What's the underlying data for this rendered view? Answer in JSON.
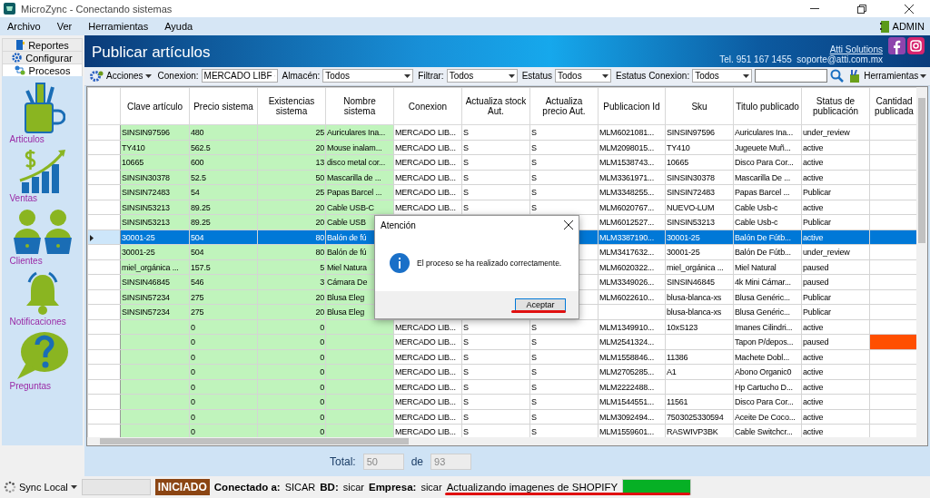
{
  "window": {
    "title": "MicroZync - Conectando sistemas"
  },
  "menu": [
    "Archivo",
    "Ver",
    "Herramientas",
    "Ayuda"
  ],
  "user": "ADMIN",
  "sidebar": {
    "tabs": [
      {
        "label": "Reportes",
        "kind": "book",
        "selected": false
      },
      {
        "label": "Configurar",
        "kind": "gear",
        "selected": false
      },
      {
        "label": "Procesos",
        "kind": "flow",
        "selected": true
      }
    ],
    "items": [
      {
        "label": "Articulos",
        "kind": "articles"
      },
      {
        "label": "Ventas",
        "kind": "sales"
      },
      {
        "label": "Clientes",
        "kind": "clients"
      },
      {
        "label": "Notificaciones",
        "kind": "bell"
      },
      {
        "label": "Preguntas",
        "kind": "question"
      }
    ]
  },
  "header": {
    "title": "Publicar artículos",
    "company": "Atti Solutions",
    "contact": "Tel. 951 167 1455  soporte@atti.com.mx"
  },
  "toolbar": {
    "actions": "Acciones",
    "filters": [
      {
        "label": "Conexion:",
        "value": "MERCADO LIBF"
      },
      {
        "label": "Almacén:",
        "value": "Todos"
      },
      {
        "label": "Filtrar:",
        "value": "Todos"
      },
      {
        "label": "Estatus",
        "value": "Todos"
      },
      {
        "label": "Estatus Conexion:",
        "value": "Todos"
      }
    ],
    "tools": "Herramientas"
  },
  "table": {
    "columns": [
      "Clave artículo",
      "Precio sistema",
      "Existencias sistema",
      "Nombre sistema",
      "Conexion",
      "Actualiza stock Aut.",
      "Actualiza precio Aut.",
      "Publicacion Id",
      "Sku",
      "Titulo publicado",
      "Status de publicación",
      "Cantidad publicada"
    ],
    "rows": [
      {
        "selected": false,
        "alert": false,
        "cells": [
          "SINSIN97596",
          "480",
          "25",
          "Auriculares Ina...",
          "MERCADO LIB...",
          "S",
          "S",
          "MLM6021081...",
          "SINSIN97596",
          "Auriculares Ina...",
          "under_review",
          null
        ]
      },
      {
        "selected": false,
        "alert": false,
        "cells": [
          "TY410",
          "562.5",
          "20",
          "Mouse inalam...",
          "MERCADO LIB...",
          "S",
          "S",
          "MLM2098015...",
          "TY410",
          "Jugeuete Muñ...",
          "active",
          null
        ]
      },
      {
        "selected": false,
        "alert": false,
        "cells": [
          "10665",
          "600",
          "13",
          "disco metal cor...",
          "MERCADO LIB...",
          "S",
          "S",
          "MLM1538743...",
          "10665",
          "Disco Para Cor...",
          "active",
          null
        ]
      },
      {
        "selected": false,
        "alert": false,
        "cells": [
          "SINSIN30378",
          "52.5",
          "50",
          "Mascarilla de ...",
          "MERCADO LIB...",
          "S",
          "S",
          "MLM3361971...",
          "SINSIN30378",
          "Mascarilla De ...",
          "active",
          null
        ]
      },
      {
        "selected": false,
        "alert": false,
        "cells": [
          "SINSIN72483",
          "54",
          "25",
          "Papas Barcel ...",
          "MERCADO LIB...",
          "S",
          "S",
          "MLM3348255...",
          "SINSIN72483",
          "Papas Barcel ...",
          "Publicar",
          null
        ]
      },
      {
        "selected": false,
        "alert": false,
        "cells": [
          "SINSIN53213",
          "89.25",
          "20",
          "Cable USB-C",
          "MERCADO LIB...",
          "S",
          "S",
          "MLM6020767...",
          "NUEVO-LUM",
          "Cable Usb-c",
          "active",
          null
        ]
      },
      {
        "selected": false,
        "alert": false,
        "cells": [
          "SINSIN53213",
          "89.25",
          "20",
          "Cable USB",
          null,
          null,
          null,
          "MLM6012527...",
          "SINSIN53213",
          "Cable Usb-c",
          "Publicar",
          null
        ]
      },
      {
        "selected": true,
        "alert": false,
        "cells": [
          "30001-25",
          "504",
          "80",
          "Balón de fú",
          null,
          null,
          null,
          "MLM3387190...",
          "30001-25",
          "Balón De Fútb...",
          "active",
          null
        ]
      },
      {
        "selected": false,
        "alert": false,
        "cells": [
          "30001-25",
          "504",
          "80",
          "Balón de fú",
          null,
          null,
          null,
          "MLM3417632...",
          "30001-25",
          "Balón De Fútb...",
          "under_review",
          null
        ]
      },
      {
        "selected": false,
        "alert": false,
        "cells": [
          "miel_orgánica ...",
          "157.5",
          "5",
          "Miel Natura",
          null,
          null,
          null,
          "MLM6020322...",
          "miel_orgánica ...",
          "Miel Natural",
          "paused",
          null
        ]
      },
      {
        "selected": false,
        "alert": false,
        "cells": [
          "SINSIN46845",
          "546",
          "3",
          "Cámara De",
          null,
          null,
          null,
          "MLM3349026...",
          "SINSIN46845",
          "4k Mini Cámar...",
          "paused",
          null
        ]
      },
      {
        "selected": false,
        "alert": false,
        "cells": [
          "SINSIN57234",
          "275",
          "20",
          "Blusa Eleg",
          null,
          null,
          null,
          "MLM6022610...",
          "blusa-blanca-xs",
          "Blusa Genéric...",
          "Publicar",
          null
        ]
      },
      {
        "selected": false,
        "alert": false,
        "cells": [
          "SINSIN57234",
          "275",
          "20",
          "Blusa Eleg",
          null,
          null,
          null,
          null,
          "blusa-blanca-xs",
          "Blusa Genéric...",
          "Publicar",
          null
        ]
      },
      {
        "selected": false,
        "alert": false,
        "cells": [
          null,
          "0",
          "0",
          null,
          "MERCADO LIB...",
          "S",
          "S",
          "MLM1349910...",
          "10xS123",
          "Imanes Cilindri...",
          "active",
          null
        ]
      },
      {
        "selected": false,
        "alert": true,
        "cells": [
          null,
          "0",
          "0",
          null,
          "MERCADO LIB...",
          "S",
          "S",
          "MLM2541324...",
          null,
          "Tapon P/depos...",
          "paused",
          null
        ]
      },
      {
        "selected": false,
        "alert": false,
        "cells": [
          null,
          "0",
          "0",
          null,
          "MERCADO LIB...",
          "S",
          "S",
          "MLM1558846...",
          "11386",
          "Machete Dobl...",
          "active",
          null
        ]
      },
      {
        "selected": false,
        "alert": false,
        "cells": [
          null,
          "0",
          "0",
          null,
          "MERCADO LIB...",
          "S",
          "S",
          "MLM2705285...",
          "A1",
          "Abono Organic0",
          "active",
          null
        ]
      },
      {
        "selected": false,
        "alert": false,
        "cells": [
          null,
          "0",
          "0",
          null,
          "MERCADO LIB...",
          "S",
          "S",
          "MLM2222488...",
          null,
          "Hp Cartucho D...",
          "active",
          null
        ]
      },
      {
        "selected": false,
        "alert": false,
        "cells": [
          null,
          "0",
          "0",
          null,
          "MERCADO LIB...",
          "S",
          "S",
          "MLM1544551...",
          "11561",
          "Disco Para Cor...",
          "active",
          null
        ]
      },
      {
        "selected": false,
        "alert": false,
        "cells": [
          null,
          "0",
          "0",
          null,
          "MERCADO LIB...",
          "S",
          "S",
          "MLM3092494...",
          "7503025330594",
          "Aceite De Coco...",
          "active",
          null
        ]
      },
      {
        "selected": false,
        "alert": false,
        "cells": [
          null,
          "0",
          "0",
          null,
          "MERCADO LIB...",
          "S",
          "S",
          "MLM1559601...",
          "RASWIVP3BK",
          "Cable Switchcr...",
          "active",
          null
        ]
      }
    ]
  },
  "footer": {
    "total_label": "Total:",
    "shown": "50",
    "of_label": "de",
    "total": "93"
  },
  "status": {
    "sync": "Sync Local",
    "state": "INICIADO",
    "items": [
      {
        "label": "Conectado a:",
        "value": "SICAR"
      },
      {
        "label": "BD:",
        "value": "sicar"
      },
      {
        "label": "Empresa:",
        "value": "sicar"
      }
    ],
    "message": "Actualizando imagenes de SHOPIFY",
    "level": 1
  },
  "dialog": {
    "title": "Atención",
    "message": "El proceso se ha realizado correctamente.",
    "button": "Aceptar"
  }
}
